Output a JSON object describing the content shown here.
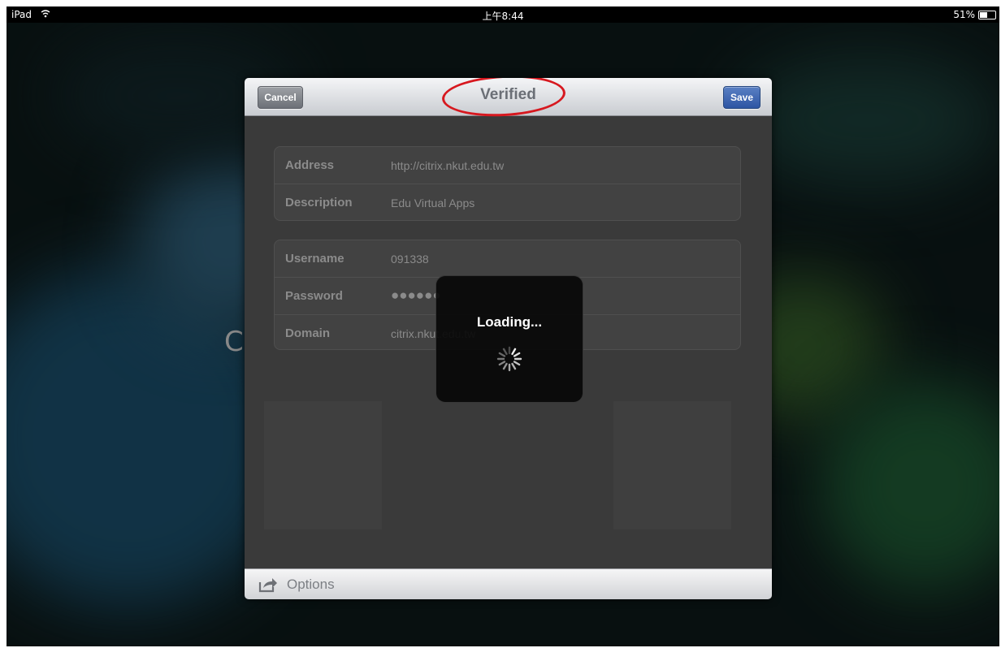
{
  "status_bar": {
    "device": "iPad",
    "wifi_icon": "wifi-icon",
    "time": "上午8:44",
    "battery_text": "51%",
    "battery_level": 0.51
  },
  "background": {
    "partial_glyph": "C"
  },
  "dialog": {
    "title": "Verified",
    "title_annotation_color": "#d7181f",
    "cancel_label": "Cancel",
    "save_label": "Save",
    "server_group": [
      {
        "label": "Address",
        "value": "http://citrix.nkut.edu.tw"
      },
      {
        "label": "Description",
        "value": "Edu Virtual Apps"
      }
    ],
    "credentials_group": [
      {
        "label": "Username",
        "value": "091338"
      },
      {
        "label": "Password",
        "value": "●●●●●●"
      },
      {
        "label": "Domain",
        "value": "citrix.nkut.edu.tw"
      }
    ],
    "footer": {
      "options_icon": "share-icon",
      "options_label": "Options"
    }
  },
  "loading": {
    "text": "Loading...",
    "spinner_icon": "spinner-icon"
  },
  "colors": {
    "save_button": "#2d55a3",
    "cancel_button": "#6c7077",
    "annotation": "#d7181f"
  }
}
